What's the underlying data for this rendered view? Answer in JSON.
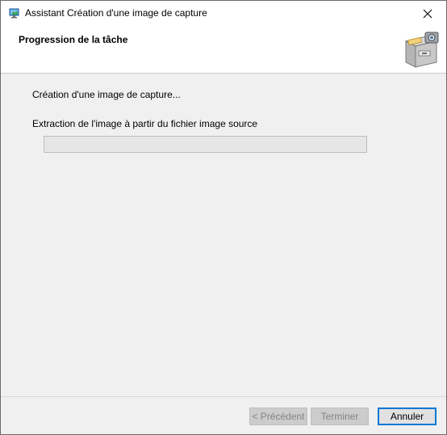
{
  "window": {
    "title": "Assistant Création d'une image de capture",
    "close_label": "✕"
  },
  "header": {
    "title": "Progression de la tâche"
  },
  "main": {
    "status": "Création d'une image de capture...",
    "step": "Extraction de l'image à partir du fichier image source",
    "progress_percent": 0
  },
  "footer": {
    "prev_label": "< Précédent",
    "finish_label": "Terminer",
    "cancel_label": "Annuler"
  },
  "colors": {
    "progress_fill": "#06b025",
    "accent": "#0078d7"
  }
}
